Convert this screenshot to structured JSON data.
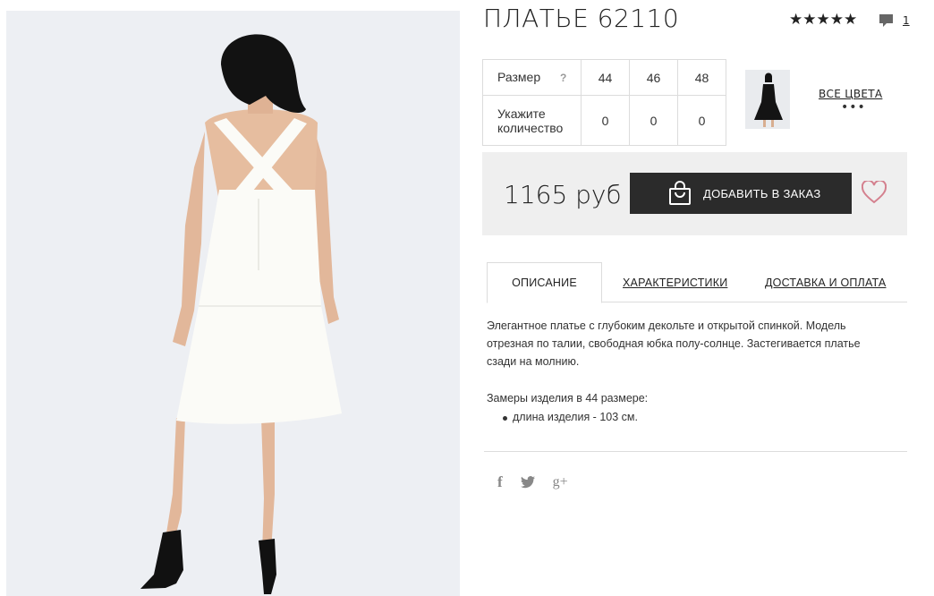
{
  "product": {
    "title": "ПЛАТЬЕ 62110",
    "rating_stars": "★★★★★",
    "reviews_count": "1"
  },
  "size_table": {
    "size_label": "Размер",
    "hint": "?",
    "qty_label": "Укажите количество",
    "sizes": [
      "44",
      "46",
      "48"
    ],
    "quantities": [
      "0",
      "0",
      "0"
    ]
  },
  "colors": {
    "all_colors_label": "ВСЕ ЦВЕТА",
    "more": "•••"
  },
  "order": {
    "price": "1165 руб",
    "add_button_label": "ДОБАВИТЬ В ЗАКАЗ"
  },
  "tabs": [
    {
      "label": "ОПИСАНИЕ"
    },
    {
      "label": "ХАРАКТЕРИСТИКИ"
    },
    {
      "label": "ДОСТАВКА И ОПЛАТА"
    }
  ],
  "description": {
    "text": "Элегантное платье с глубоким декольте и открытой спинкой. Модель отрезная по талии, свободная юбка полу-солнце. Застегивается платье сзади на молнию.",
    "measurements_title": "Замеры изделия в 44 размере:",
    "measurements": [
      "длина изделия - 103 см."
    ]
  },
  "social": {
    "facebook_icon": "f",
    "googleplus_icon": "g+"
  },
  "colors_palette": {
    "dark_button": "#2b2b2b",
    "order_bar_bg": "#efefef",
    "heart": "#d4808e",
    "photo_bg": "#edeff3"
  }
}
